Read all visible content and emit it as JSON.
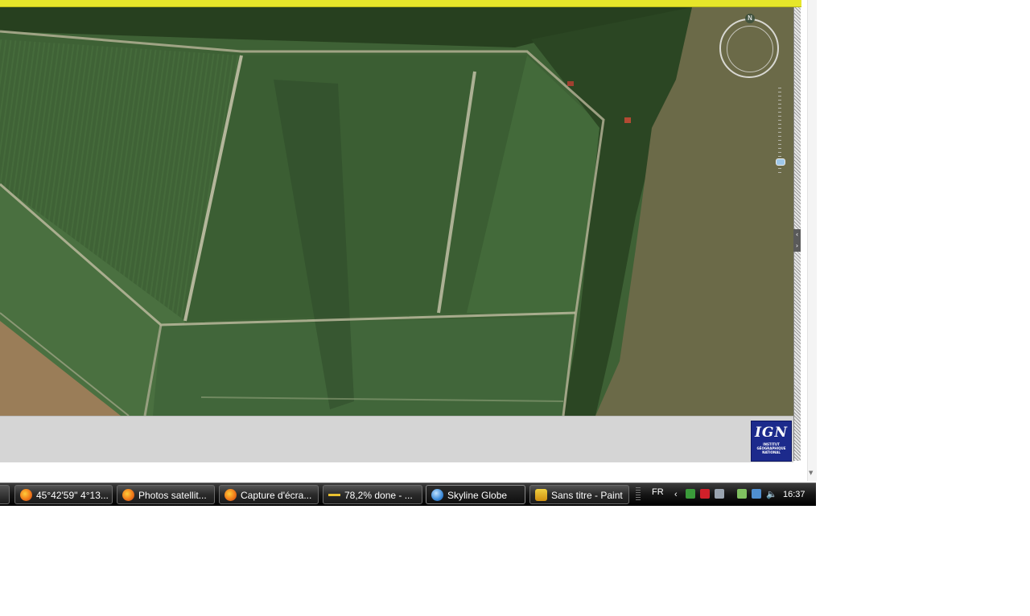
{
  "map": {
    "compass_letter": "N"
  },
  "logo": {
    "brand": "IGN",
    "subtitle": "INSTITUT GÉOGRAPHIQUE NATIONAL"
  },
  "taskbar": {
    "items": [
      {
        "label": "45°42'59'' 4°13...",
        "icon": "firefox-icon"
      },
      {
        "label": "Photos satellit...",
        "icon": "firefox-icon"
      },
      {
        "label": "Capture d'écra...",
        "icon": "firefox-icon"
      },
      {
        "label": "78,2% done - ...",
        "icon": "download-progress-icon"
      },
      {
        "label": "Skyline Globe",
        "icon": "globe-icon"
      },
      {
        "label": "Sans titre - Paint",
        "icon": "paint-icon"
      }
    ],
    "tray": {
      "language": "FR",
      "clock": "16:37"
    }
  },
  "colors": {
    "header_yellow": "#e6e62a",
    "field_green": "#3f6236",
    "lake": "#6b6a48",
    "logo_blue": "#1c2a8c"
  }
}
